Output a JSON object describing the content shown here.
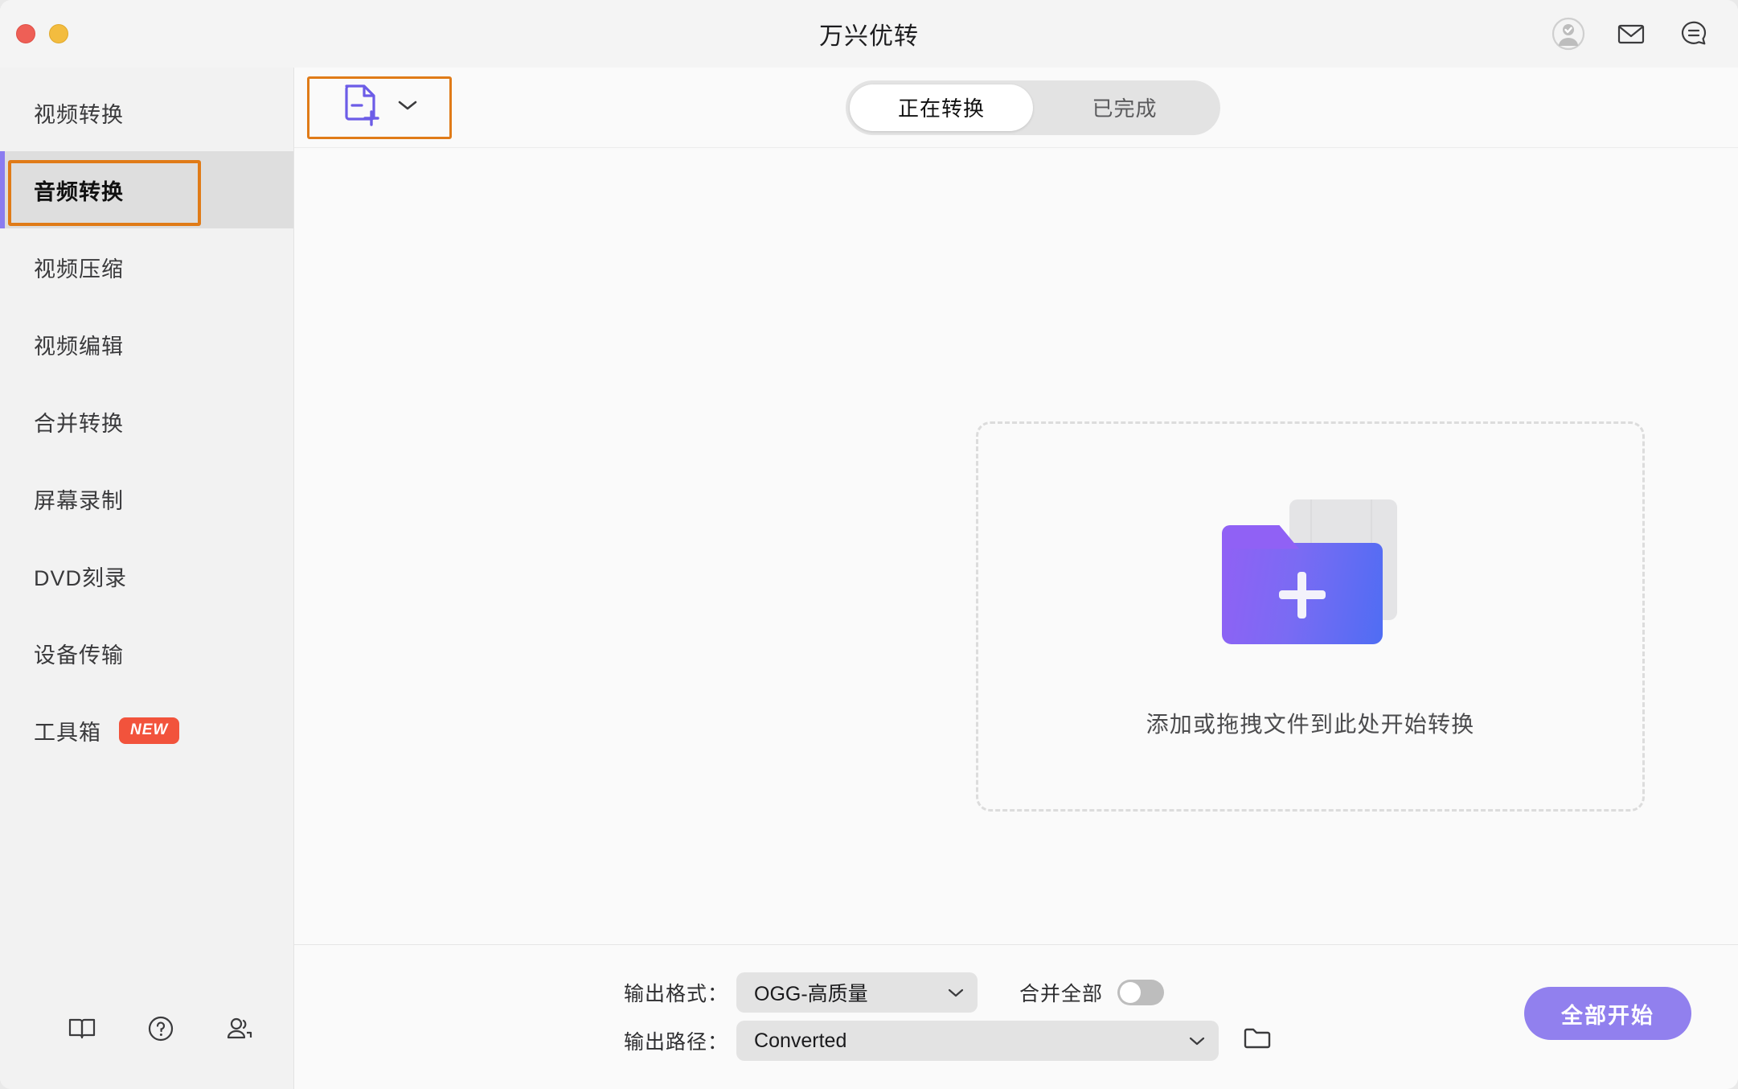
{
  "window": {
    "title": "万兴优转",
    "traffic_lights": [
      "close",
      "minimize"
    ],
    "accent_purple": "#9180ee",
    "annotation_orange": "#e07b18"
  },
  "title_actions": [
    {
      "name": "account-avatar-icon",
      "label": "账户"
    },
    {
      "name": "mail-icon",
      "label": "消息"
    },
    {
      "name": "chat-bubble-icon",
      "label": "反馈"
    }
  ],
  "sidebar": {
    "items": [
      {
        "label": "视频转换",
        "active": false,
        "badge": ""
      },
      {
        "label": "音频转换",
        "active": true,
        "badge": ""
      },
      {
        "label": "视频压缩",
        "active": false,
        "badge": ""
      },
      {
        "label": "视频编辑",
        "active": false,
        "badge": ""
      },
      {
        "label": "合并转换",
        "active": false,
        "badge": ""
      },
      {
        "label": "屏幕录制",
        "active": false,
        "badge": ""
      },
      {
        "label": "DVD刻录",
        "active": false,
        "badge": ""
      },
      {
        "label": "设备传输",
        "active": false,
        "badge": ""
      },
      {
        "label": "工具箱",
        "active": false,
        "badge": "NEW"
      }
    ],
    "footer_icons": [
      {
        "name": "book-icon",
        "label": "使用指南"
      },
      {
        "name": "help-circle-icon",
        "label": "帮助"
      },
      {
        "name": "community-users-icon",
        "label": "社区"
      }
    ]
  },
  "toolbar": {
    "add_file": {
      "name": "add-file-icon",
      "label": "添加文件",
      "dropdown": "chevron-down-icon"
    },
    "tabs": [
      {
        "label": "正在转换",
        "active": true
      },
      {
        "label": "已完成",
        "active": false
      }
    ]
  },
  "dropzone": {
    "text": "添加或拖拽文件到此处开始转换",
    "icon": "folder-plus-illustration"
  },
  "bottom": {
    "format_label": "输出格式：",
    "format_value": "OGG-高质量",
    "merge_label": "合并全部",
    "merge_on": false,
    "path_label": "输出路径：",
    "path_value": "Converted",
    "browse_icon": "folder-icon",
    "start_label": "全部开始"
  }
}
